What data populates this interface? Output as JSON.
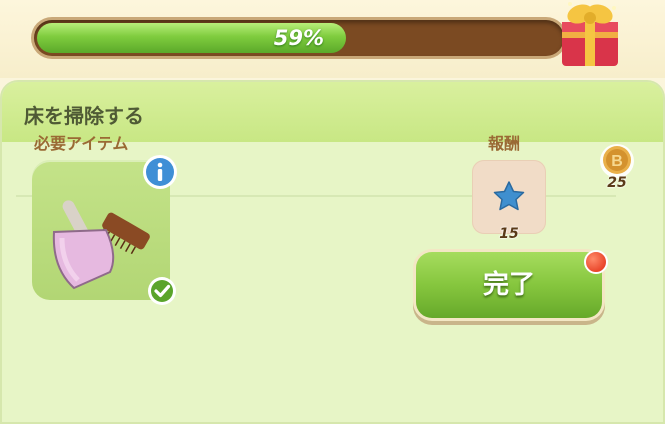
{
  "header": {
    "title_partial": "",
    "progress": {
      "value_percent": 59,
      "label": "59%"
    },
    "gift_icon": "gift-box-icon"
  },
  "task": {
    "title": "床を掃除する",
    "coin_reward": {
      "icon": "coin-icon",
      "count": "25"
    }
  },
  "required_items": {
    "label": "必要アイテム",
    "item_icon": "dustpan-and-brush-icon",
    "info_icon": "info-icon",
    "status_icon": "checkmark-icon"
  },
  "reward": {
    "label": "報酬",
    "icon": "blue-star-icon",
    "count": "15"
  },
  "actions": {
    "complete_label": "完了",
    "notification_dot_color": "#e02a10"
  },
  "colors": {
    "accent_green": "#7fcc3e",
    "progress_track": "#7b4a22",
    "label_brown": "#9a6a34"
  }
}
